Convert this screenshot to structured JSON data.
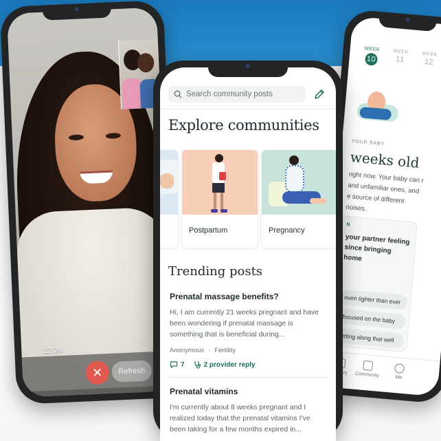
{
  "colors": {
    "brand_blue": "#1a79bd",
    "accent_green": "#1f6f5c",
    "end_call_red": "#e25a4f"
  },
  "video_call": {
    "time": "12:24",
    "refresh_label": "Refresh",
    "end_icon": "close-icon"
  },
  "timeline": {
    "weeks": [
      {
        "label": "WEEK",
        "num": "10",
        "active": true
      },
      {
        "label": "WEEK",
        "num": "11",
        "active": false
      },
      {
        "label": "WEEK",
        "num": "12",
        "active": false
      }
    ],
    "section_label": "YOUR BABY",
    "heading": "weeks old",
    "description": "right now. Your baby can r and unfamiliar ones, and e source of different noises.",
    "partner_tag": "N",
    "partner_question": "your partner feeling since bringing home",
    "options": [
      "oven tighter than ever",
      "focused on the baby",
      "etting along that well"
    ],
    "nav": {
      "library": "Library",
      "community": "Community",
      "me": "Me"
    }
  },
  "community": {
    "search_placeholder": "Search community posts",
    "heading": "Explore communities",
    "cards": [
      {
        "label": ""
      },
      {
        "label": "Postpartum"
      },
      {
        "label": "Pregnancy"
      }
    ],
    "trending_heading": "Trending posts",
    "posts": [
      {
        "title": "Prenatal massage benefits?",
        "body": "Hi, I am currently 21 weeks pregnant and have been wondering if prenatal massage is something that is beneficial during...",
        "author": "Anonymous",
        "category": "Fertility",
        "comments": "7",
        "provider_replies": "2 provider reply"
      },
      {
        "title": "Prenatal vitamins",
        "body": "I'm currently about 8 weeks pregnant and I realized today that the prenatal vitamins I've been taking for a few months expired in..."
      }
    ]
  }
}
